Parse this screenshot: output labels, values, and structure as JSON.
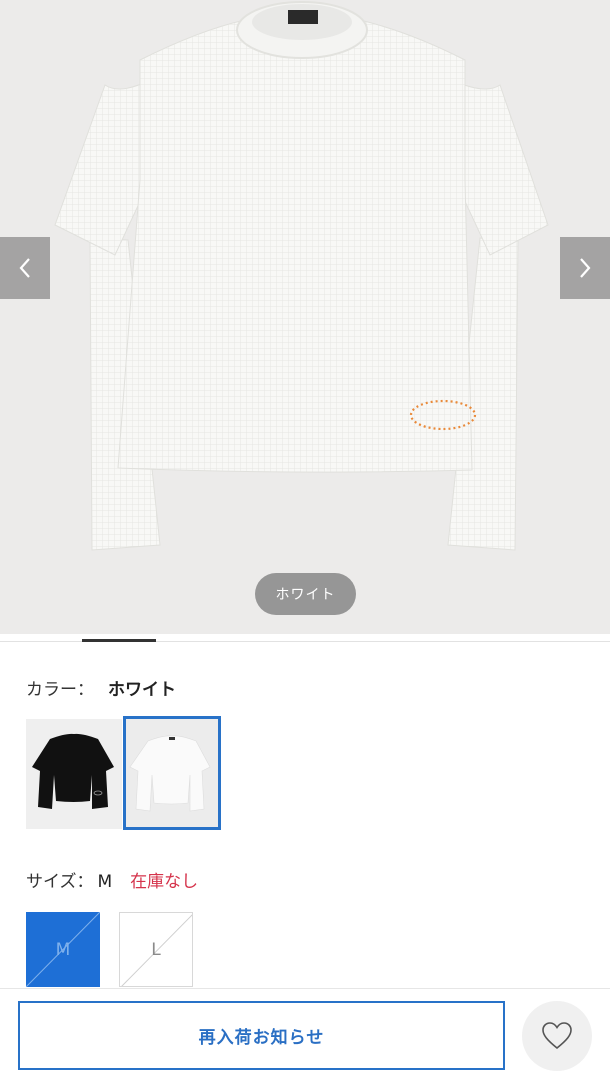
{
  "product_image": {
    "current_color_label": "ホワイト",
    "prev_icon": "chevron-left-icon",
    "next_icon": "chevron-right-icon"
  },
  "color": {
    "label": "カラー：",
    "selected": "ホワイト",
    "swatches": [
      {
        "name": "ブラック",
        "shirt_color": "#111111",
        "selected": false
      },
      {
        "name": "ホワイト",
        "shirt_color": "#f7f7f5",
        "selected": true
      }
    ]
  },
  "size": {
    "label": "サイズ：",
    "selected": "M",
    "stock_status": "在庫なし",
    "options": [
      {
        "label": "M",
        "selected": true,
        "sold_out": true
      },
      {
        "label": "L",
        "selected": false,
        "sold_out": true
      }
    ]
  },
  "actions": {
    "restock_label": "再入荷お知らせ",
    "favorite_icon": "heart-icon"
  },
  "colors": {
    "accent": "#1e6fd6",
    "stock_alert": "#d5334b",
    "logo_orange": "#e98a3a"
  }
}
